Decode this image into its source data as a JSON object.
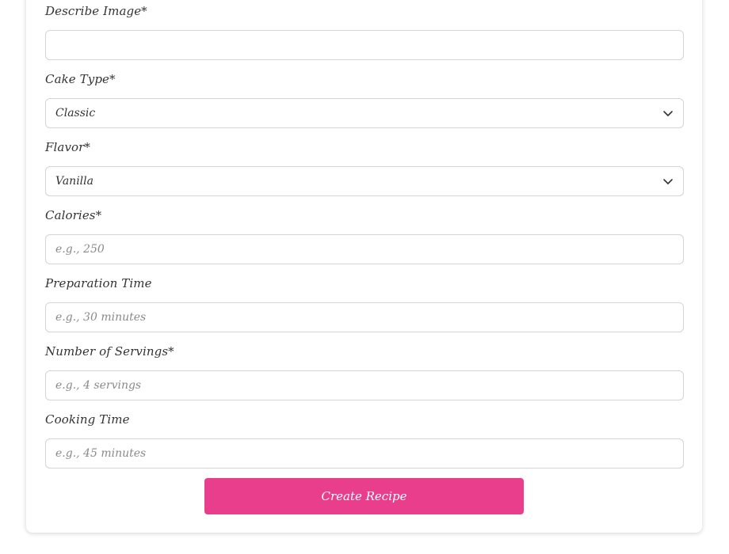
{
  "form": {
    "describe_image": {
      "label": "Describe Image*",
      "value": "",
      "placeholder": ""
    },
    "cake_type": {
      "label": "Cake Type*",
      "selected": "Classic",
      "icon": "chevron-down-icon"
    },
    "flavor": {
      "label": "Flavor*",
      "selected": "Vanilla",
      "icon": "chevron-down-icon"
    },
    "calories": {
      "label": "Calories*",
      "value": "",
      "placeholder": "e.g., 250"
    },
    "preparation_time": {
      "label": "Preparation Time",
      "value": "",
      "placeholder": "e.g., 30 minutes"
    },
    "servings": {
      "label": "Number of Servings*",
      "value": "",
      "placeholder": "e.g., 4 servings"
    },
    "cooking_time": {
      "label": "Cooking Time",
      "value": "",
      "placeholder": "e.g., 45 minutes"
    },
    "submit_label": "Create Recipe"
  },
  "colors": {
    "accent": "#e83e8c",
    "input_border": "#d4d4d4"
  }
}
